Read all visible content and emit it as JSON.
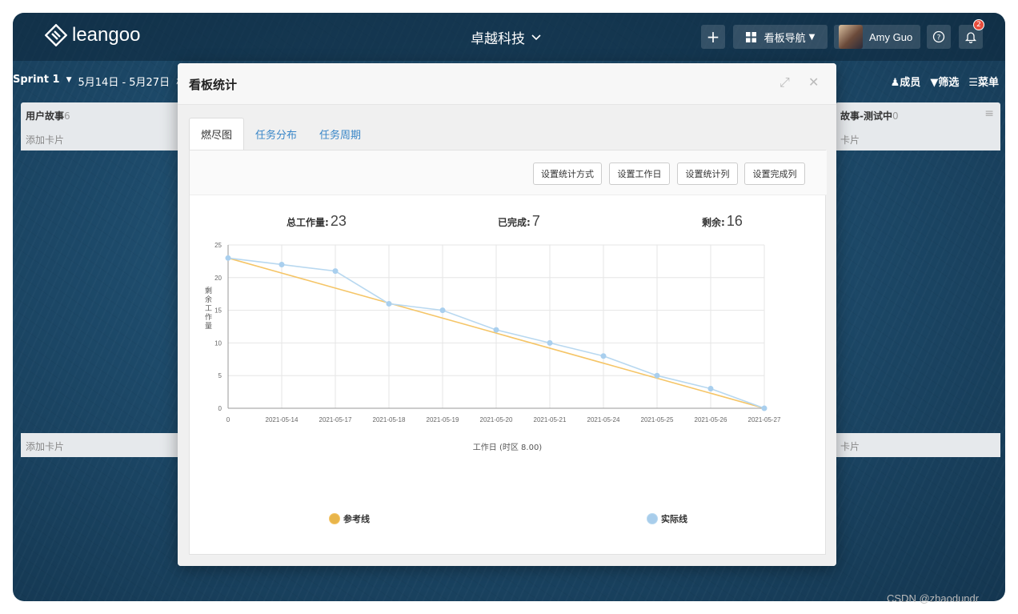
{
  "app": {
    "logo_text": "leangoo",
    "board_name": "卓越科技",
    "board_nav_label": "看板导航",
    "user_name": "Amy Guo",
    "notification_count": "2"
  },
  "sprint": {
    "name": "Sprint 1",
    "dates": "5月14日 - 5月27日",
    "extra": "极",
    "actions": [
      "成员",
      "筛选",
      "菜单"
    ]
  },
  "lists": [
    {
      "name": "用户故事",
      "count": "6",
      "add": "添加卡片",
      "footer_add": "添加卡片"
    },
    {
      "name": "故事-测试中",
      "count": "0",
      "add": "卡片",
      "footer_add": "卡片"
    }
  ],
  "modal": {
    "title": "看板统计",
    "tabs": [
      "燃尽图",
      "任务分布",
      "任务周期"
    ],
    "buttons": [
      "设置统计方式",
      "设置工作日",
      "设置统计列",
      "设置完成列"
    ],
    "stats": {
      "total_label": "总工作量:",
      "total": "23",
      "done_label": "已完成:",
      "done": "7",
      "remain_label": "剩余:",
      "remain": "16"
    }
  },
  "chart_data": {
    "type": "line",
    "title": "",
    "xlabel": "工作日 (时区 8.00)",
    "ylabel": "剩余工作量",
    "categories": [
      "0",
      "2021-05-14",
      "2021-05-17",
      "2021-05-18",
      "2021-05-19",
      "2021-05-20",
      "2021-05-21",
      "2021-05-24",
      "2021-05-25",
      "2021-05-26",
      "2021-05-27"
    ],
    "ylim": [
      0,
      25
    ],
    "yticks": [
      0,
      5,
      10,
      15,
      20,
      25
    ],
    "grid": true,
    "legend_position": "bottom",
    "series": [
      {
        "name": "参考线",
        "color": "#f5c567",
        "legend_color": "#e8b54a",
        "values": [
          23,
          20.7,
          18.4,
          16.1,
          13.8,
          11.5,
          9.2,
          6.9,
          4.6,
          2.3,
          0
        ]
      },
      {
        "name": "实际线",
        "color": "#b8d8f0",
        "legend_color": "#a8cdeb",
        "values": [
          23,
          22,
          21,
          16,
          15,
          12,
          10,
          8,
          5,
          3,
          0
        ]
      }
    ]
  },
  "watermark": "CSDN @zhaodundr"
}
